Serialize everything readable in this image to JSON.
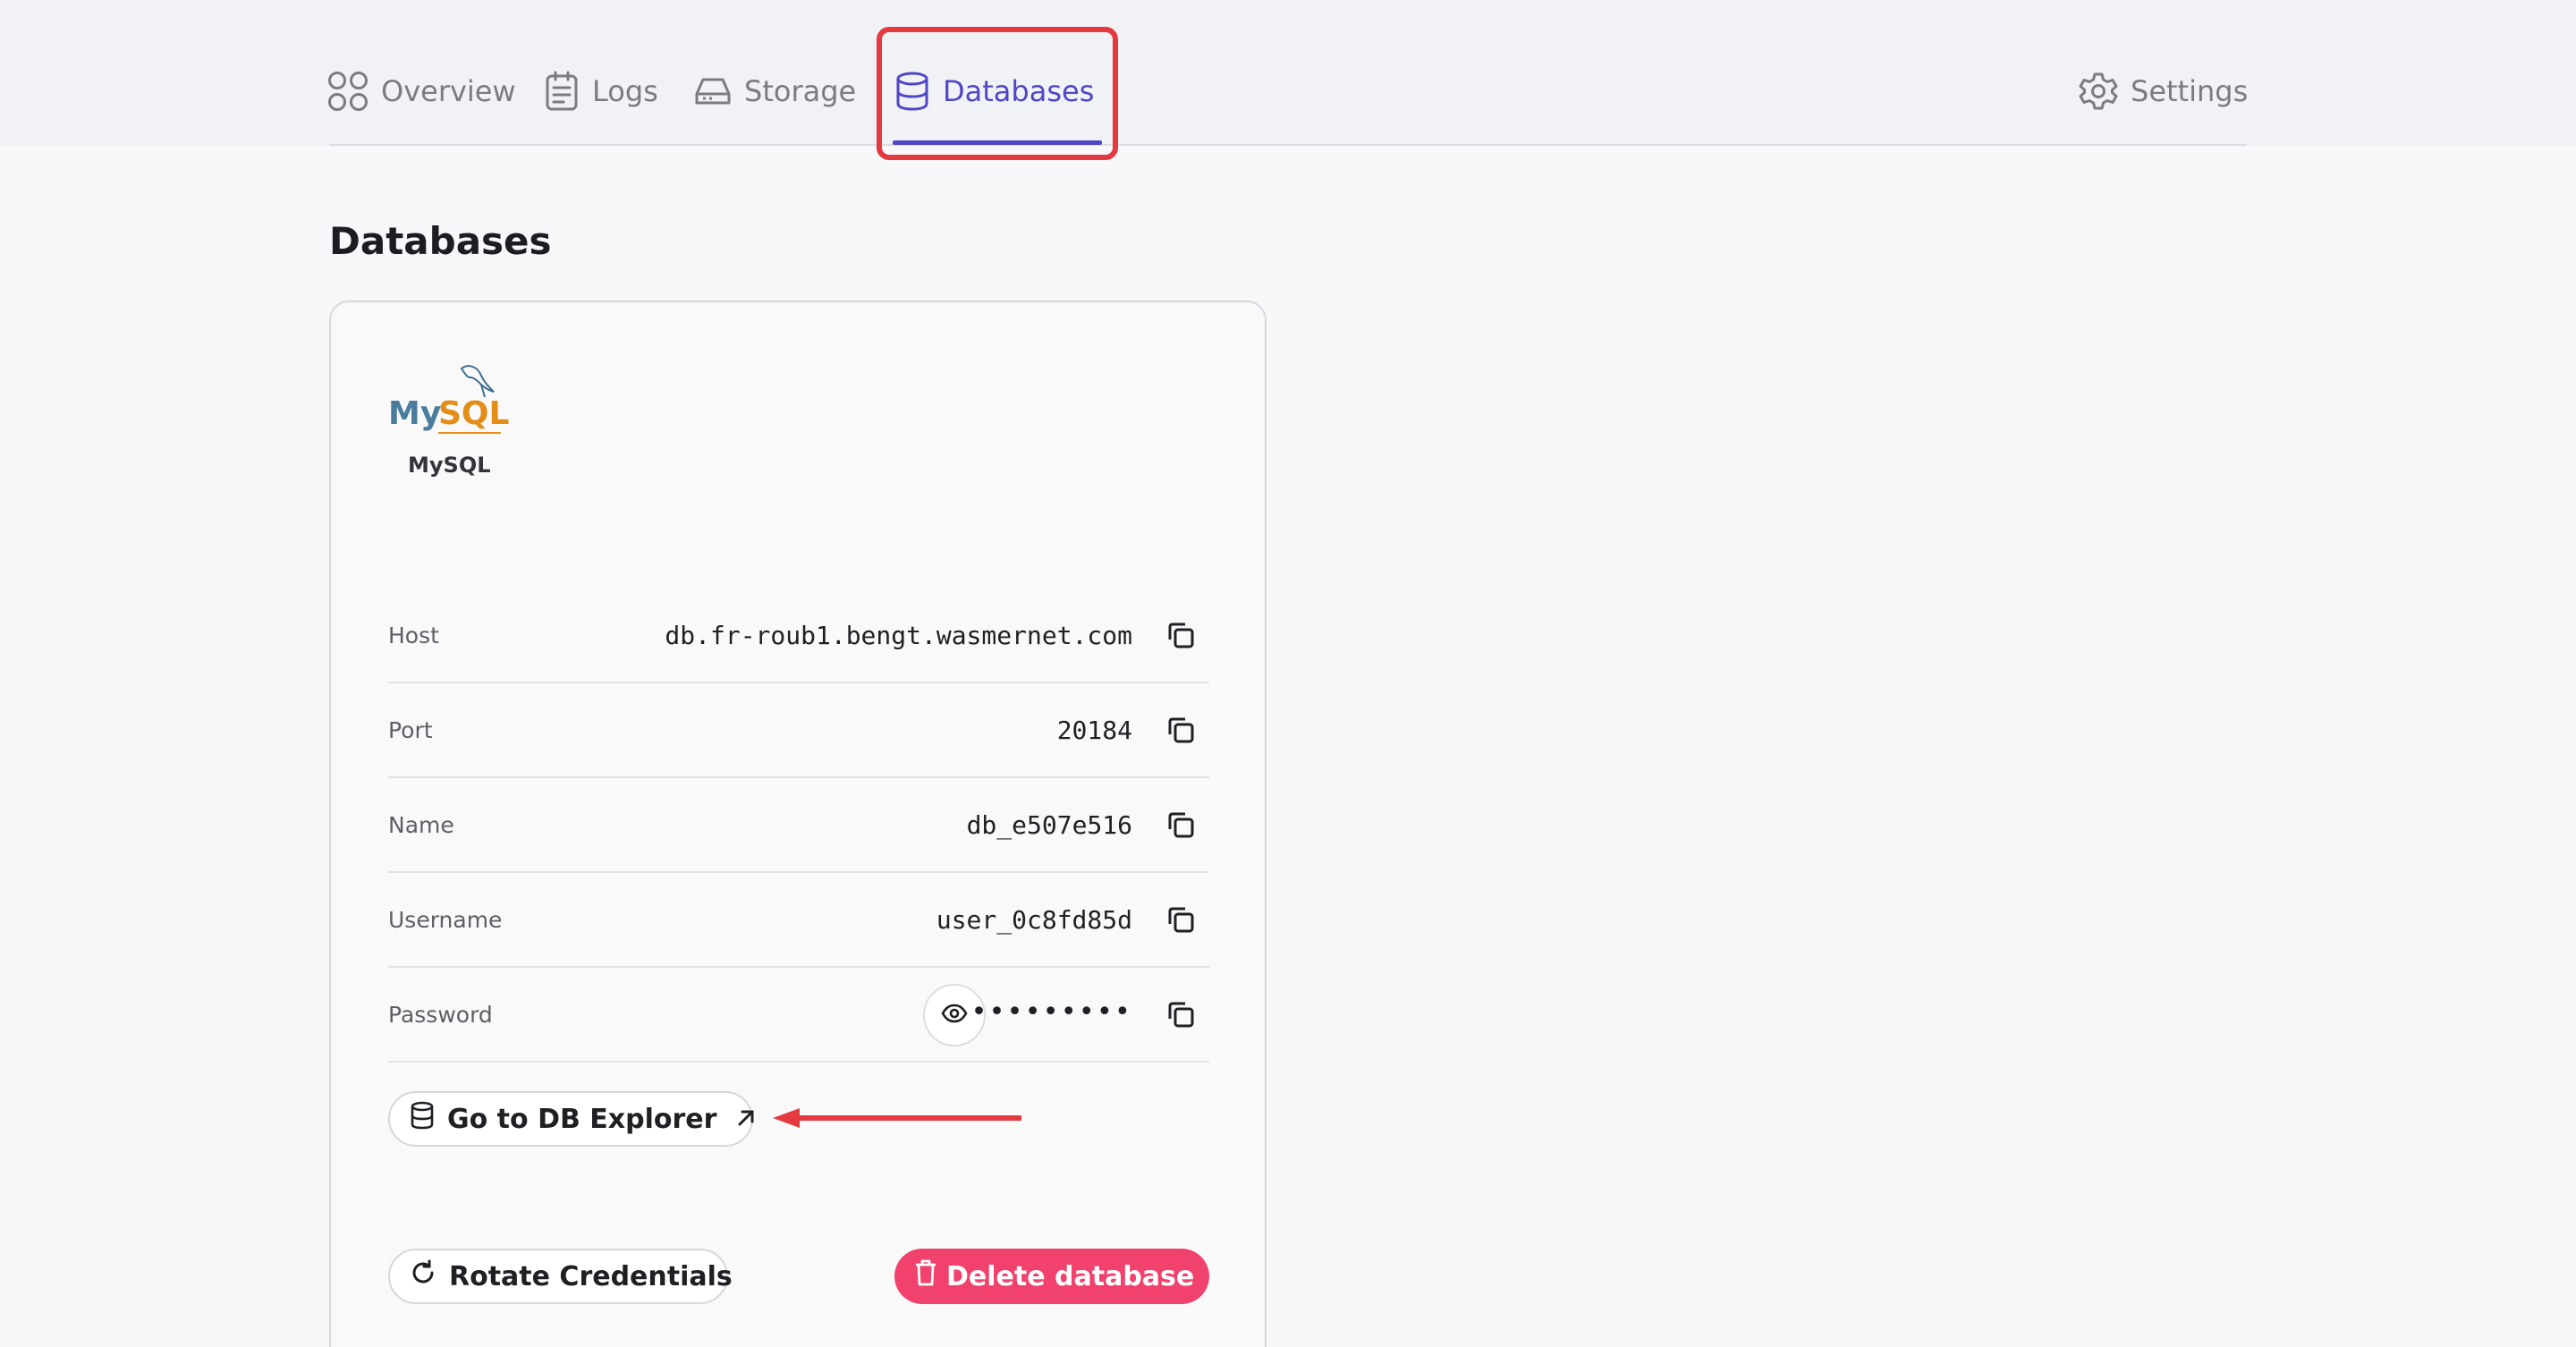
{
  "nav": {
    "overview": "Overview",
    "logs": "Logs",
    "storage": "Storage",
    "databases": "Databases",
    "settings": "Settings",
    "accent_color": "#4f46c8"
  },
  "page": {
    "title": "Databases"
  },
  "database": {
    "logo_text_my": "My",
    "logo_text_sql": "SQL",
    "engine_name": "MySQL",
    "fields": [
      {
        "label": "Host",
        "value": "db.fr-roub1.bengt.wasmernet.com"
      },
      {
        "label": "Port",
        "value": "20184"
      },
      {
        "label": "Name",
        "value": "db_e507e516"
      },
      {
        "label": "Username",
        "value": "user_0c8fd85d"
      },
      {
        "label": "Password",
        "value": "•••••••••"
      }
    ]
  },
  "actions": {
    "explorer": "Go to DB Explorer",
    "rotate": "Rotate Credentials",
    "delete": "Delete database",
    "delete_color": "#f0426d"
  },
  "annotation": {
    "highlight_color": "#e3393f"
  }
}
